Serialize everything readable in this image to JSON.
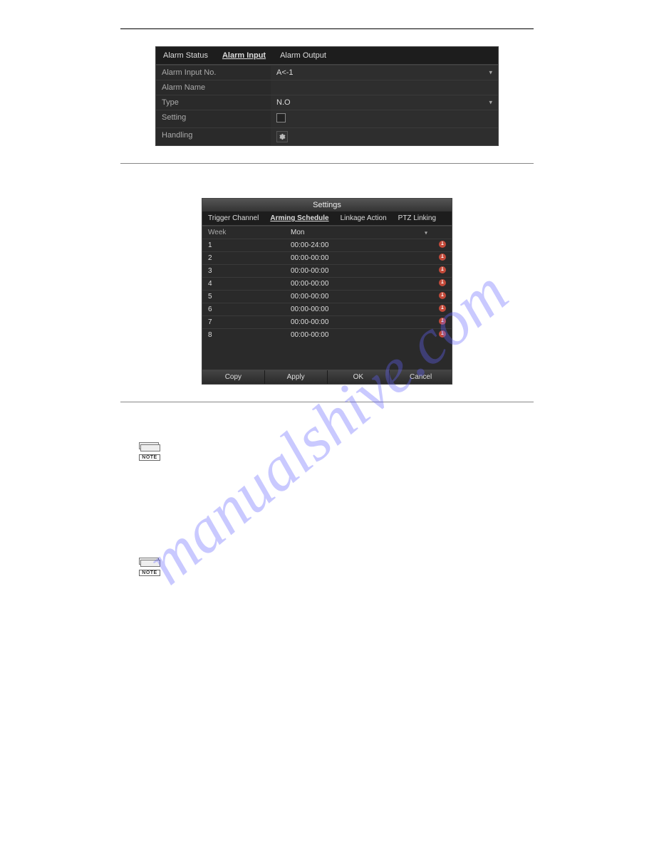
{
  "watermark": "manualshive.com",
  "panel1": {
    "tabs": [
      "Alarm Status",
      "Alarm Input",
      "Alarm Output"
    ],
    "active_tab": 1,
    "rows": {
      "alarm_input_no": {
        "label": "Alarm Input No.",
        "value": "A<-1",
        "dropdown": true
      },
      "alarm_name": {
        "label": "Alarm Name",
        "value": "",
        "dropdown": false
      },
      "type": {
        "label": "Type",
        "value": "N.O",
        "dropdown": true
      },
      "setting": {
        "label": "Setting",
        "kind": "checkbox"
      },
      "handling": {
        "label": "Handling",
        "kind": "gear"
      }
    }
  },
  "panel2": {
    "title": "Settings",
    "tabs": [
      "Trigger Channel",
      "Arming Schedule",
      "Linkage Action",
      "PTZ Linking"
    ],
    "active_tab": 1,
    "week": {
      "label": "Week",
      "value": "Mon"
    },
    "rows": [
      {
        "idx": "1",
        "time": "00:00-24:00"
      },
      {
        "idx": "2",
        "time": "00:00-00:00"
      },
      {
        "idx": "3",
        "time": "00:00-00:00"
      },
      {
        "idx": "4",
        "time": "00:00-00:00"
      },
      {
        "idx": "5",
        "time": "00:00-00:00"
      },
      {
        "idx": "6",
        "time": "00:00-00:00"
      },
      {
        "idx": "7",
        "time": "00:00-00:00"
      },
      {
        "idx": "8",
        "time": "00:00-00:00"
      }
    ],
    "buttons": [
      "Copy",
      "Apply",
      "OK",
      "Cancel"
    ]
  },
  "notes": {
    "label": "NOTE"
  }
}
